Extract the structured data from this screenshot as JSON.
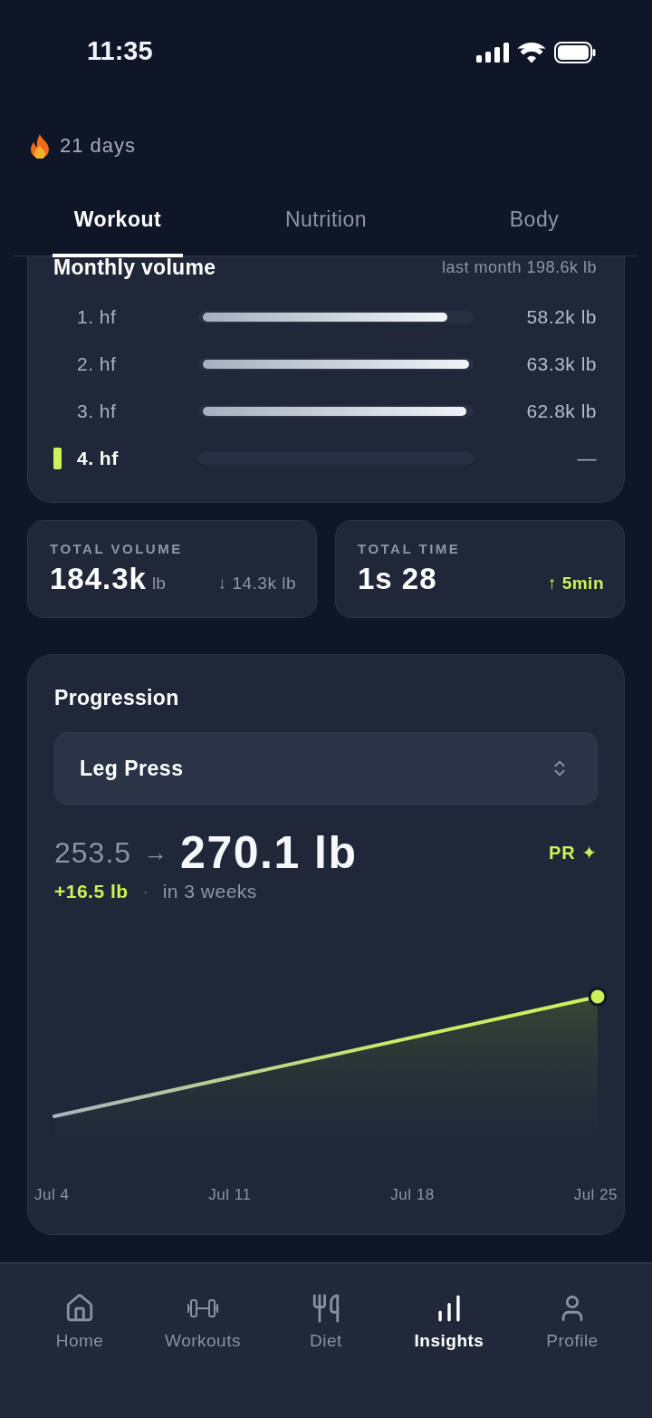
{
  "status_bar": {
    "time": "11:35"
  },
  "streak": {
    "label": "21 days"
  },
  "tabs": [
    {
      "label": "Workout",
      "selected": true
    },
    {
      "label": "Nutrition",
      "selected": false
    },
    {
      "label": "Body",
      "selected": false
    }
  ],
  "monthly_volume": {
    "title": "Monthly volume",
    "comparison": "last month 198.6k lb",
    "rows": [
      {
        "label": "1. hf",
        "level": 0.92,
        "value": "58.2k lb",
        "selected": false
      },
      {
        "label": "2. hf",
        "level": 1.0,
        "value": "63.3k lb",
        "selected": false
      },
      {
        "label": "3. hf",
        "level": 0.99,
        "value": "62.8k lb",
        "selected": false
      },
      {
        "label": "4. hf",
        "value": "—",
        "selected": true
      }
    ]
  },
  "stats": [
    {
      "label": "TOTAL VOLUME",
      "value": "184.3k",
      "unit": "lb",
      "change": "↓ 14.3k lb",
      "color": "#8d96a8"
    },
    {
      "label": "TOTAL TIME",
      "value": "1s 28",
      "change": "↑ 5min",
      "color": "#cdf15a"
    }
  ],
  "progression": {
    "title": "Progression",
    "exercise": "Leg Press",
    "from": "253.5",
    "arrow": "→",
    "to": "270.1 lb",
    "badge": "PR ✦",
    "gain": "+16.5 lb",
    "separator": "·",
    "period": "in 3 weeks",
    "x_labels": [
      "Jul 4",
      "Jul 11",
      "Jul 18",
      "Jul 25"
    ]
  },
  "nav": [
    {
      "label": "Home",
      "selected": false
    },
    {
      "label": "Workouts",
      "selected": false
    },
    {
      "label": "Diet",
      "selected": false
    },
    {
      "label": "Insights",
      "selected": true
    },
    {
      "label": "Profile",
      "selected": false
    }
  ]
}
